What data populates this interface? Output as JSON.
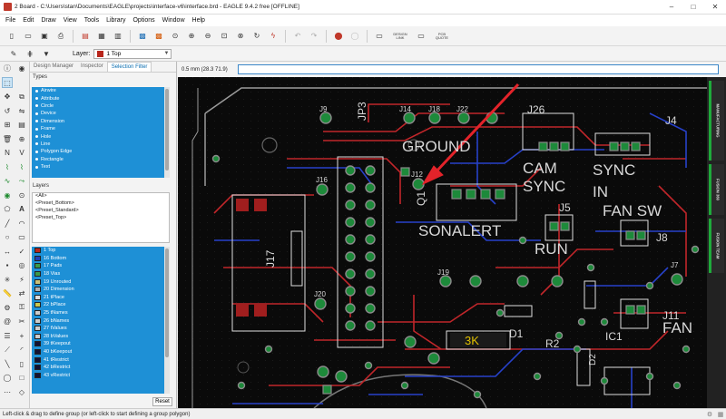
{
  "window": {
    "title": "2 Board - C:\\Users\\stan\\Documents\\EAGLE\\projects\\interface-v6\\interface.brd - EAGLE 9.4.2 free [OFFLINE]"
  },
  "menu": [
    "File",
    "Edit",
    "Draw",
    "View",
    "Tools",
    "Library",
    "Options",
    "Window",
    "Help"
  ],
  "toolbar": {
    "design_link": "DESIGN LINK",
    "pcb_quote": "PCB QUOTE"
  },
  "layer_bar": {
    "label": "Layer:",
    "selected": "1 Top",
    "color": "#b8261c"
  },
  "panel": {
    "tabs": [
      "Design Manager",
      "Inspector",
      "Selection Filter"
    ],
    "types_label": "Types",
    "types": [
      "Airwire",
      "Attribute",
      "Circle",
      "Device",
      "Dimension",
      "Frame",
      "Hole",
      "Line",
      "Polygon Edge",
      "Rectangle",
      "Text"
    ],
    "layers_label": "Layers",
    "presets": [
      "<All>",
      "<Preset_Bottom>",
      "<Preset_Standard>",
      "<Preset_Top>"
    ],
    "layers": [
      {
        "name": "1 Top",
        "color": "#b8261c"
      },
      {
        "name": "16 Bottom",
        "color": "#1f3fb5"
      },
      {
        "name": "17 Pads",
        "color": "#3a9a4a"
      },
      {
        "name": "18 Vias",
        "color": "#3a9a4a"
      },
      {
        "name": "19 Unrouted",
        "color": "#c9c07a"
      },
      {
        "name": "20 Dimension",
        "color": "#b0b0b0"
      },
      {
        "name": "21 tPlace",
        "color": "#dddddd"
      },
      {
        "name": "22 bPlace",
        "color": "#c8c850"
      },
      {
        "name": "25 tNames",
        "color": "#cccccc"
      },
      {
        "name": "26 bNames",
        "color": "#cccccc"
      },
      {
        "name": "27 tValues",
        "color": "#cccccc"
      },
      {
        "name": "28 bValues",
        "color": "#cccccc"
      },
      {
        "name": "39 tKeepout",
        "color": "#111133"
      },
      {
        "name": "40 bKeepout",
        "color": "#111133"
      },
      {
        "name": "41 tRestrict",
        "color": "#111133"
      },
      {
        "name": "42 bRestrict",
        "color": "#111133"
      },
      {
        "name": "43 vRestrict",
        "color": "#111133"
      }
    ],
    "reset": "Reset"
  },
  "coord": "0.5 mm (28.3 71.9)",
  "board_labels": [
    "GROUND",
    "CAM",
    "SYNC",
    "SYNC",
    "IN",
    "FAN SW",
    "SONALERT",
    "RUN",
    "FAN",
    "JP3",
    "J17",
    "J26",
    "J4",
    "J5",
    "J8",
    "J9",
    "J11",
    "J12",
    "J14",
    "J16",
    "J18",
    "J19",
    "J20",
    "J22",
    "J7",
    "Q1",
    "3K",
    "D1",
    "R2",
    "IC1",
    "D2"
  ],
  "right_tabs": [
    "MANUFACTURING",
    "FUSION 360",
    "FUSION TEAM"
  ],
  "status": "Left-click & drag to define group (or left-click to start defining a group polygon)"
}
